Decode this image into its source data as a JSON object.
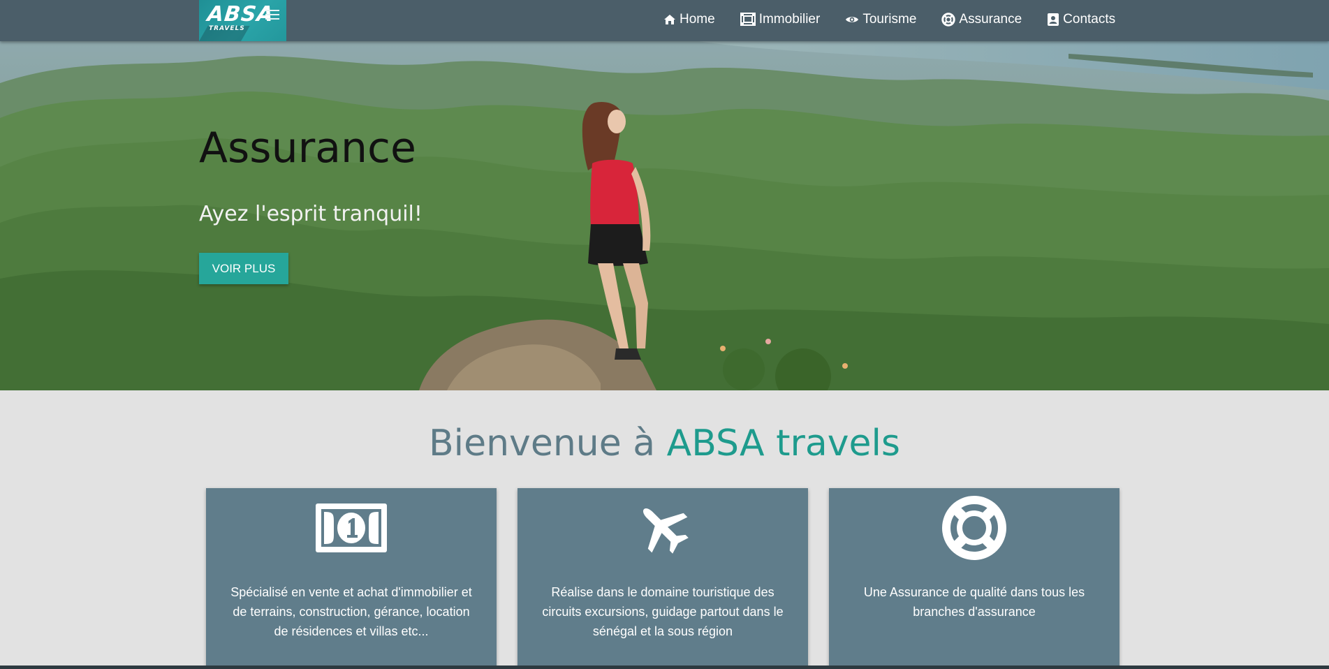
{
  "brand": {
    "logo_word": "ABSA",
    "logo_sub": "TRAVELS"
  },
  "nav": {
    "items": [
      {
        "label": "Home",
        "icon": "home-icon"
      },
      {
        "label": "Immobilier",
        "icon": "building-icon"
      },
      {
        "label": "Tourisme",
        "icon": "eye-icon"
      },
      {
        "label": "Assurance",
        "icon": "lifebuoy-icon"
      },
      {
        "label": "Contacts",
        "icon": "contact-card-icon"
      }
    ]
  },
  "hero": {
    "title": "Assurance",
    "subtitle": "Ayez l'esprit tranquil!",
    "button_label": "VOIR PLUS"
  },
  "welcome": {
    "part1": "Bienvenue à ",
    "part2": "ABSA travels"
  },
  "cards": [
    {
      "icon": "banknote-icon",
      "text": "Spécialisé en vente et achat d'immobilier et de terrains, construction, gérance, location de résidences et villas etc..."
    },
    {
      "icon": "airplane-icon",
      "text": "Réalise dans le domaine touristique des circuits excursions, guidage partout dans le sénégal et la sous région"
    },
    {
      "icon": "lifebuoy-icon",
      "text": "Une Assurance de qualité dans tous les branches d'assurance"
    }
  ],
  "colors": {
    "navbar": "#4b5e69",
    "accent": "#26a69a",
    "card": "#607d8b",
    "welcome_grey": "#5e7b87",
    "welcome_teal": "#1e9b8d",
    "page_bg": "#e2e2e2"
  }
}
